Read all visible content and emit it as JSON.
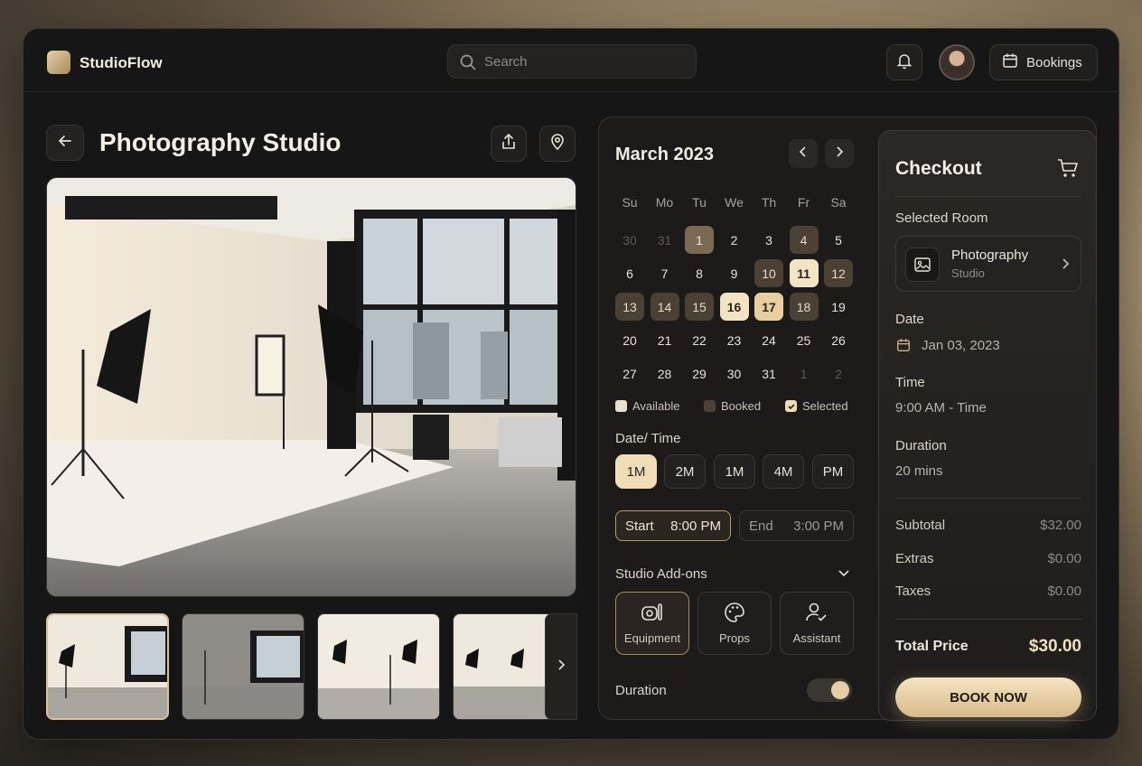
{
  "app": {
    "brand": "StudioFlow"
  },
  "header": {
    "search_placeholder": "Search",
    "bookings_label": "Bookings"
  },
  "page": {
    "title": "Photography Studio"
  },
  "calendar": {
    "month_label": "March 2023",
    "weekdays": [
      "Su",
      "Mo",
      "Tu",
      "We",
      "Th",
      "Fr",
      "Sa"
    ],
    "weeks": [
      [
        "30",
        "31",
        "1",
        "2",
        "3",
        "4",
        "5"
      ],
      [
        "6",
        "7",
        "8",
        "9",
        "10",
        "11",
        "12"
      ],
      [
        "13",
        "14",
        "15",
        "16",
        "17",
        "18",
        "19"
      ],
      [
        "20",
        "21",
        "22",
        "23",
        "24",
        "25",
        "26"
      ],
      [
        "27",
        "28",
        "29",
        "30",
        "31",
        "1",
        "2"
      ]
    ],
    "legend": {
      "available": "Available",
      "booked": "Booked",
      "selected": "Selected"
    }
  },
  "datetime": {
    "label": "Date/ Time",
    "chips": [
      "1M",
      "2M",
      "1M",
      "4M",
      "PM"
    ],
    "start_label": "Start",
    "start_time": "8:00 PM",
    "end_label": "End",
    "end_time": "3:00 PM"
  },
  "addons": {
    "label": "Studio Add-ons",
    "items": [
      {
        "label": "Equipment",
        "icon": "equipment-icon"
      },
      {
        "label": "Props",
        "icon": "palette-icon"
      },
      {
        "label": "Assistant",
        "icon": "user-check-icon"
      }
    ]
  },
  "duration_toggle": {
    "label": "Duration",
    "on": true
  },
  "checkout": {
    "title": "Checkout",
    "selected_room_label": "Selected Room",
    "room_name": "Photography",
    "room_sub": "Studio",
    "date_label": "Date",
    "date_value": "Jan 03, 2023",
    "time_label": "Time",
    "time_value": "9:00 AM - Time",
    "duration_label": "Duration",
    "duration_value": "20 mins",
    "subtotal_label": "Subtotal",
    "subtotal_value": "$32.00",
    "extras_label": "Extras",
    "extras_value": "$0.00",
    "taxes_label": "Taxes",
    "taxes_value": "$0.00",
    "total_label": "Total Price",
    "total_value": "$30.00",
    "book_label": "BOOK NOW"
  },
  "colors": {
    "accent": "#e6cfa7",
    "panel": "#1c1b1a",
    "background": "#161616"
  }
}
